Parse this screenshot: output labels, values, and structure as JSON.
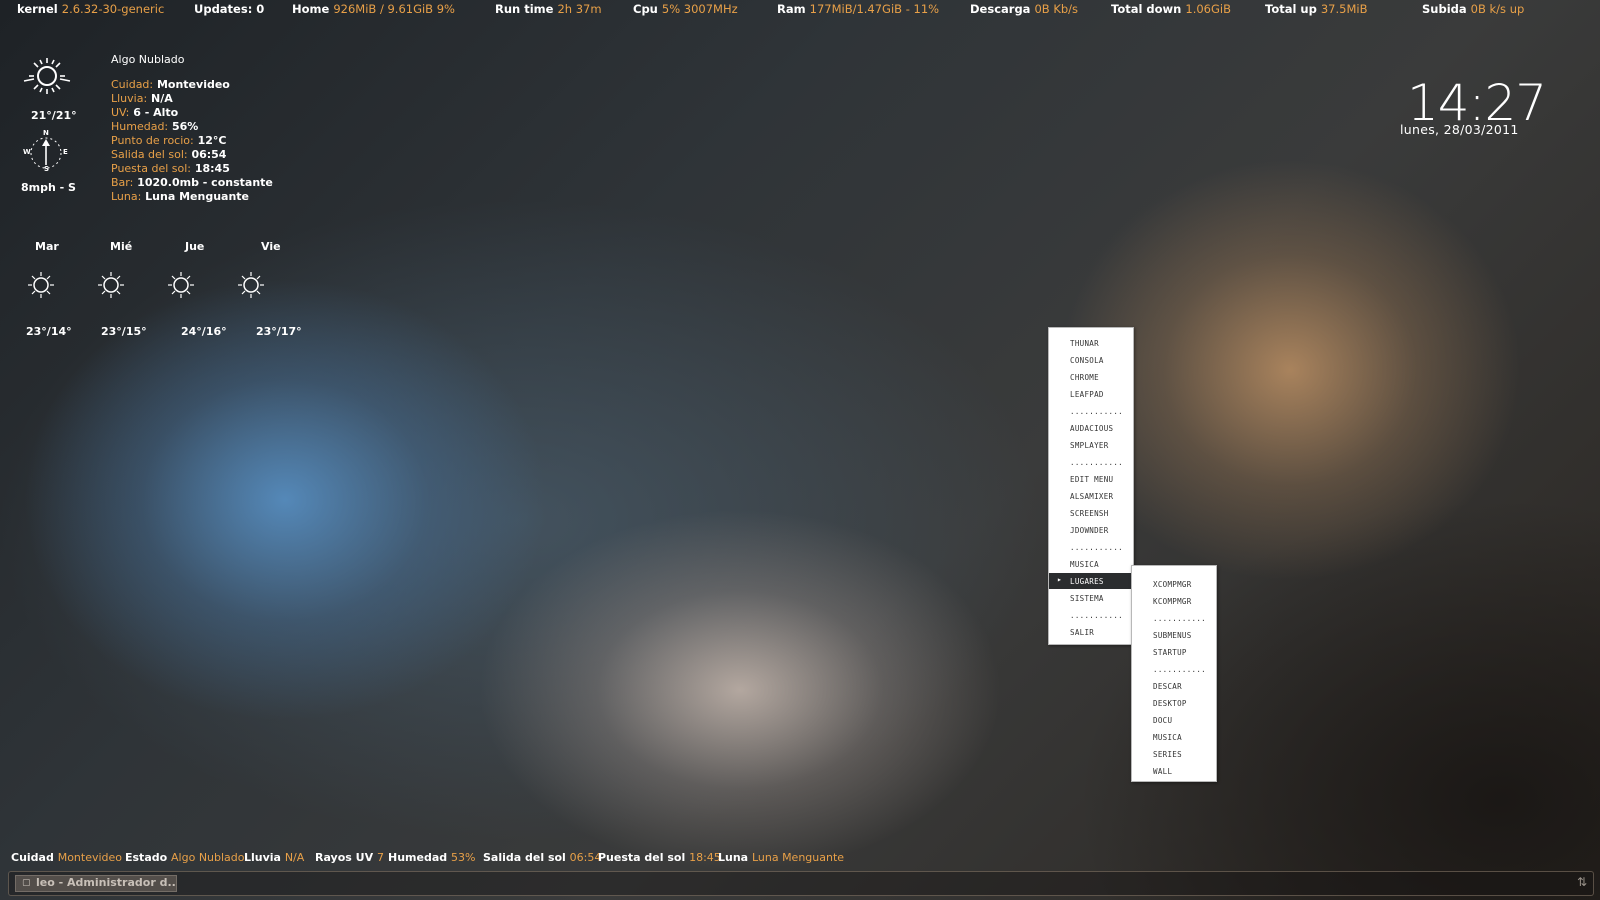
{
  "top_bar": {
    "kernel_label": "kernel",
    "kernel_value": "2.6.32-30-generic",
    "updates_label": "Updates: 0",
    "home_label": "Home",
    "home_value": "926MiB  / 9.61GiB  9%",
    "runtime_label": "Run time",
    "runtime_value": "2h 37m",
    "cpu_label": "Cpu",
    "cpu_value": "5%  3007MHz",
    "ram_label": "Ram",
    "ram_value": "177MiB/1.47GiB - 11%",
    "descarga_label": "Descarga",
    "descarga_value": "0B  Kb/s",
    "totaldown_label": "Total down",
    "totaldown_value": "1.06GiB",
    "totalup_label": "Total up",
    "totalup_value": "37.5MiB",
    "subida_label": "Subida",
    "subida_value": "0B  k/s up"
  },
  "weather": {
    "condition": "Algo Nublado",
    "current_icon": "sun-icon",
    "temp": "21°/21°",
    "compass": {
      "n": "N",
      "s": "S",
      "e": "E",
      "w": "W"
    },
    "wind": "8mph - S",
    "details": [
      {
        "label": "Cuidad:",
        "value": "Montevideo"
      },
      {
        "label": "Lluvia:",
        "value": "N/A"
      },
      {
        "label": "UV:",
        "value": "6 - Alto"
      },
      {
        "label": "Humedad:",
        "value": "56%"
      },
      {
        "label": "Punto de rocio:",
        "value": "12°C"
      },
      {
        "label": "Salida del sol:",
        "value": "06:54"
      },
      {
        "label": "Puesta del sol:",
        "value": " 18:45"
      },
      {
        "label": "Bar:",
        "value": "1020.0mb - constante"
      },
      {
        "label": "Luna:",
        "value": "Luna Menguante"
      }
    ],
    "forecast": [
      {
        "day": "Mar",
        "temp": "23°/14°",
        "icon": "sun-icon"
      },
      {
        "day": "Mié",
        "temp": "23°/15°",
        "icon": "sun-icon"
      },
      {
        "day": "Jue",
        "temp": "24°/16°",
        "icon": "sun-icon"
      },
      {
        "day": "Vie",
        "temp": "23°/17°",
        "icon": "sun-icon"
      }
    ]
  },
  "clock": {
    "time": "14:27",
    "date": "lunes, 28/03/2011"
  },
  "menu": {
    "items": [
      "THUNAR",
      "CONSOLA",
      "CHROME",
      "LEAFPAD",
      "...........",
      "AUDACIOUS",
      "SMPLAYER",
      "...........",
      "EDIT MENU",
      "ALSAMIXER",
      "SCREENSH",
      "JDOWNDER",
      "...........",
      "MUSICA",
      "LUGARES",
      "SISTEMA",
      "...........",
      "SALIR"
    ],
    "active_item": "LUGARES",
    "submenu": [
      "XCOMPMGR",
      "KCOMPMGR",
      "...........",
      "SUBMENUS",
      "STARTUP",
      "...........",
      "DESCAR",
      "DESKTOP",
      "DOCU",
      "MUSICA",
      "SERIES",
      "WALL"
    ]
  },
  "bottom_bar": {
    "cuidad_label": "Cuidad",
    "cuidad_value": "Montevideo",
    "estado_label": "Estado",
    "estado_value": "Algo Nublado",
    "lluvia_label": "Lluvia",
    "lluvia_value": "N/A",
    "uv_label": "Rayos UV",
    "uv_value": "7",
    "humedad_label": "Humedad",
    "humedad_value": "53%",
    "salida_label": "Salida del sol",
    "salida_value": "06:54",
    "puesta_label": "Puesta del sol",
    "puesta_value": "18:45",
    "luna_label": "Luna",
    "luna_value": "Luna Menguante"
  },
  "taskbar": {
    "task_label": "leo - Administrador d...",
    "task_icon": "window-icon",
    "tray_icon": "network-icon"
  },
  "colors": {
    "accent": "#e8a048",
    "text": "#ffffff",
    "menu_active": "#2b2d2f"
  }
}
